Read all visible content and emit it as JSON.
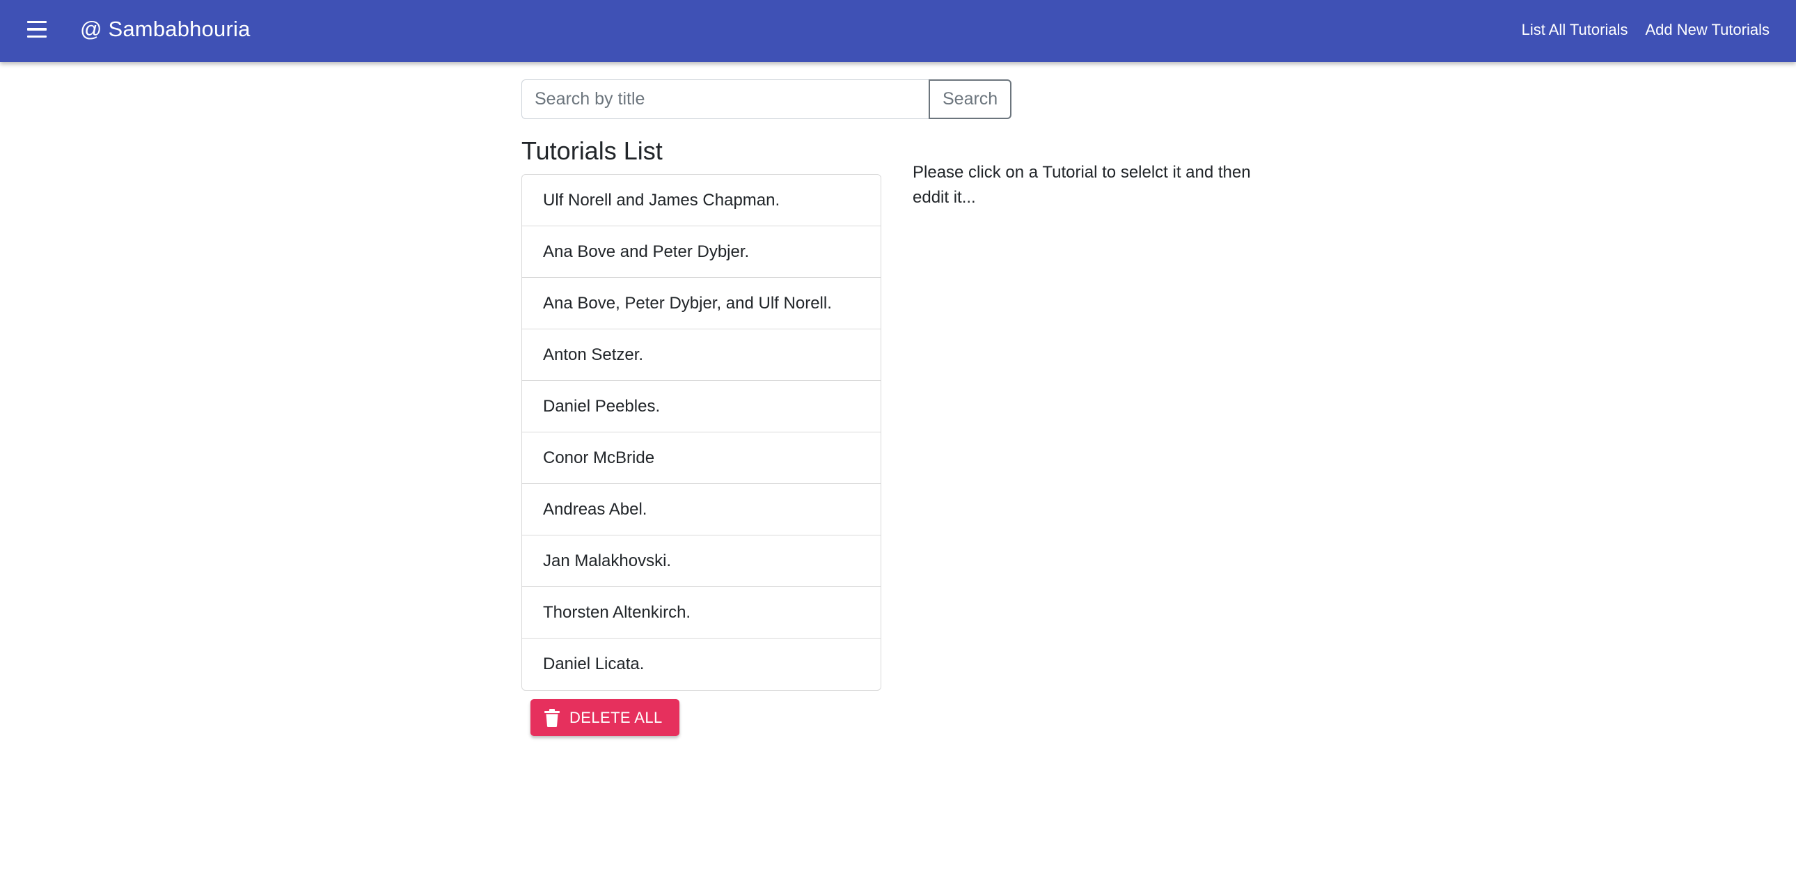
{
  "appbar": {
    "menu_icon": "hamburger-menu-icon",
    "brand": "@ Sambabhouria",
    "nav": [
      {
        "label": "List All Tutorials"
      },
      {
        "label": "Add New Tutorials"
      }
    ],
    "color": "#3f51b5"
  },
  "search": {
    "placeholder": "Search by title",
    "value": "",
    "button_label": "Search"
  },
  "list": {
    "title": "Tutorials List",
    "items": [
      {
        "title": "Ulf Norell and James Chapman."
      },
      {
        "title": "Ana Bove and Peter Dybjer."
      },
      {
        "title": "Ana Bove, Peter Dybjer, and Ulf Norell."
      },
      {
        "title": "Anton Setzer."
      },
      {
        "title": "Daniel Peebles."
      },
      {
        "title": "Conor McBride"
      },
      {
        "title": "Andreas Abel."
      },
      {
        "title": "Jan Malakhovski."
      },
      {
        "title": "Thorsten Altenkirch."
      },
      {
        "title": "Daniel Licata."
      }
    ]
  },
  "delete_all": {
    "label": "DELETE ALL",
    "icon": "trash-icon",
    "color": "#e6305d"
  },
  "detail": {
    "hint": "Please click on a Tutorial to selelct it and then eddit it..."
  }
}
